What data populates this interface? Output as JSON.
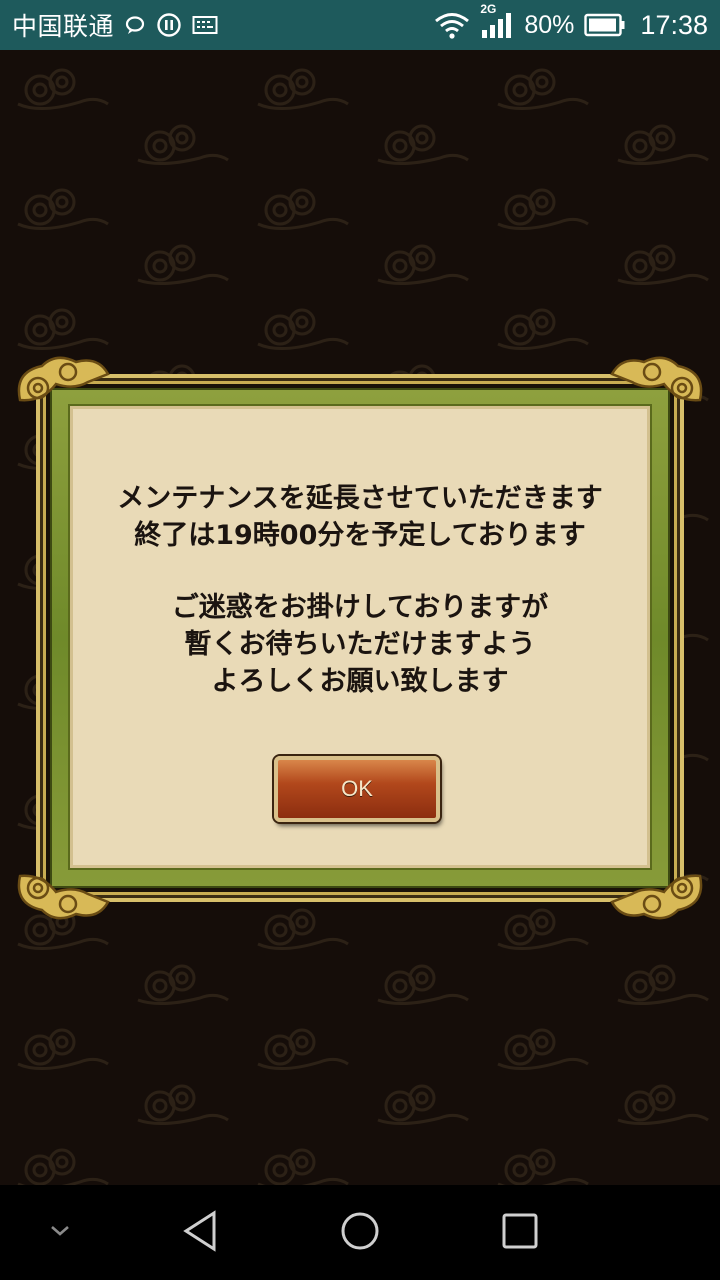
{
  "status_bar": {
    "carrier": "中国联通",
    "network": "2G",
    "battery_percent": "80%",
    "time": "17:38",
    "icons": [
      "chat-icon",
      "phone-sync-icon",
      "keyboard-icon",
      "wifi-icon",
      "signal-icon",
      "battery-icon"
    ]
  },
  "dialog": {
    "message_lines_1": [
      "メンテナンスを延長させていただきます",
      "終了は19時00分を予定しております"
    ],
    "message_lines_2": [
      "ご迷惑をお掛けしておりますが",
      "暫くお待ちいただけますよう",
      "よろしくお願い致します"
    ],
    "ok_label": "OK"
  },
  "nav_bar": {
    "icons": [
      "collapse-chevron-icon",
      "back-icon",
      "home-icon",
      "recents-icon"
    ]
  },
  "colors": {
    "status_bar": "#1e5a5c",
    "background": "#150d09",
    "frame_green": "#7d942f",
    "panel": "#e9dab7",
    "button": "#b2481c",
    "gold": "#d7bf6a"
  }
}
